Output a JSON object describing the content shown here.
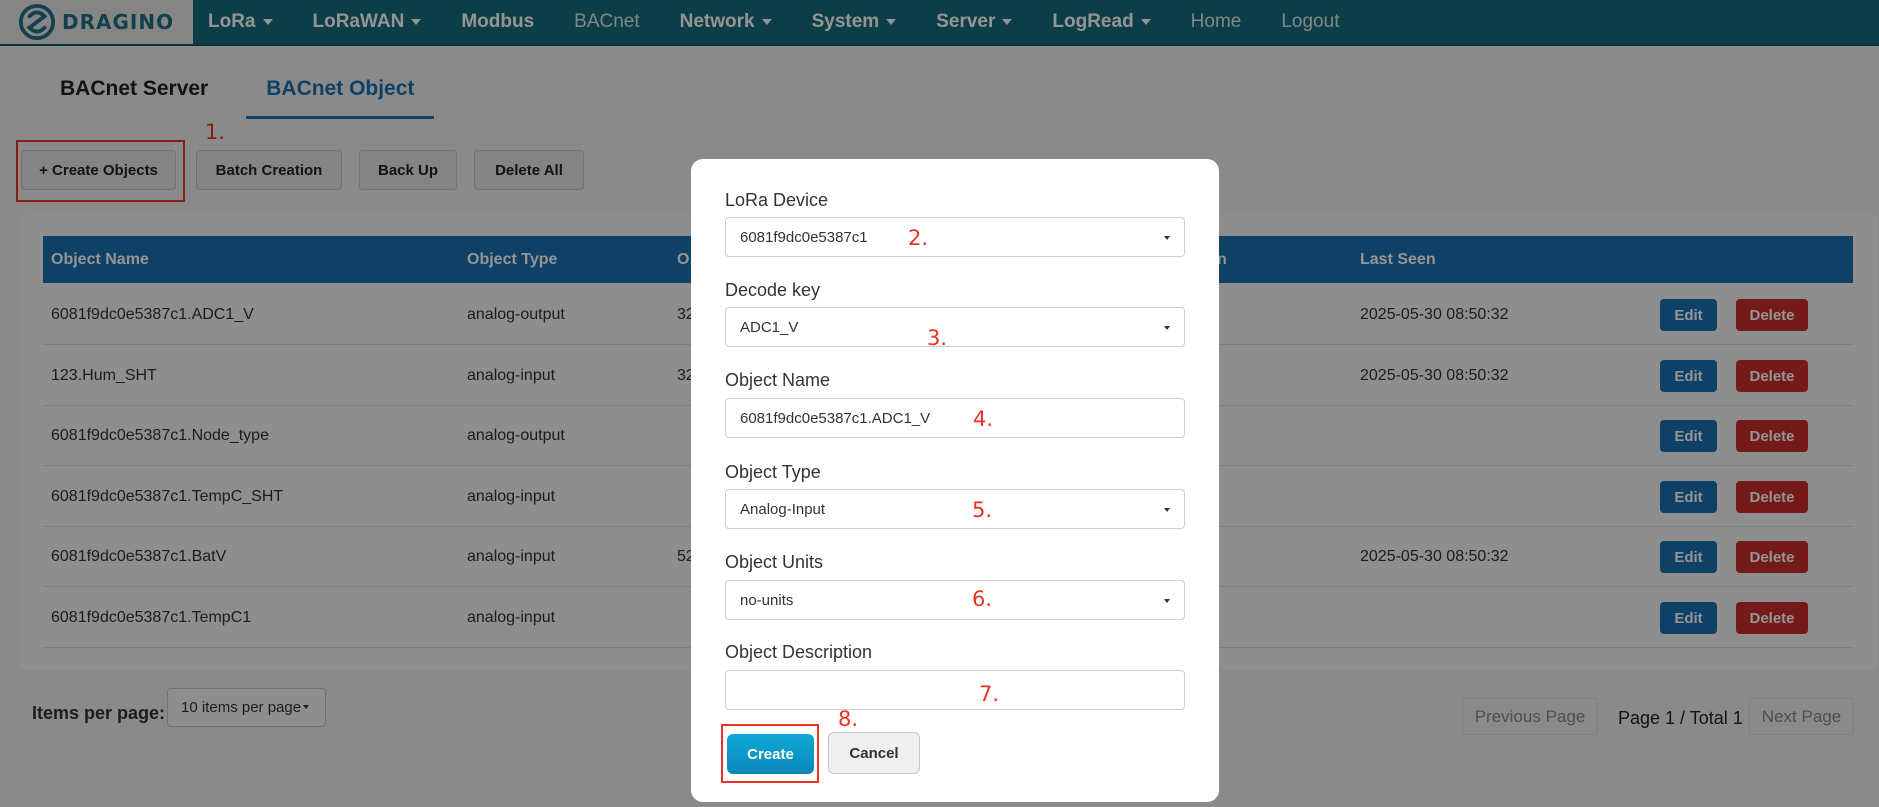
{
  "brand": {
    "name": "DRAGINO",
    "logo_icon": "dragino-logo-icon",
    "color": "#1f6f86"
  },
  "nav": {
    "items": [
      {
        "label": "LoRa",
        "dropdown": true
      },
      {
        "label": "LoRaWAN",
        "dropdown": true
      },
      {
        "label": "Modbus",
        "dropdown": false
      },
      {
        "label": "BACnet",
        "dropdown": false
      },
      {
        "label": "Network",
        "dropdown": true
      },
      {
        "label": "System",
        "dropdown": true
      },
      {
        "label": "Server",
        "dropdown": true
      },
      {
        "label": "LogRead",
        "dropdown": true
      },
      {
        "label": "Home",
        "dropdown": false
      },
      {
        "label": "Logout",
        "dropdown": false
      }
    ],
    "bg_color": "#186c7c"
  },
  "tabs": [
    {
      "label": "BACnet Server",
      "active": false
    },
    {
      "label": "BACnet Object",
      "active": true
    }
  ],
  "toolbar": {
    "create_label": "+ Create Objects",
    "batch_label": "Batch Creation",
    "backup_label": "Back Up",
    "delete_all_label": "Delete All"
  },
  "annotations": {
    "a1": "1.",
    "a2": "2.",
    "a3": "3.",
    "a4": "4.",
    "a5": "5.",
    "a6": "6.",
    "a7": "7.",
    "a8": "8.",
    "color": "#ea3323"
  },
  "table": {
    "columns": [
      "Object Name",
      "Object Type",
      "O",
      "n",
      "Last Seen"
    ],
    "rows": [
      {
        "name": "6081f9dc0e5387c1.ADC1_V",
        "type": "analog-output",
        "val": "32",
        "last_seen": "2025-05-30 08:50:32"
      },
      {
        "name": "123.Hum_SHT",
        "type": "analog-input",
        "val": "32",
        "last_seen": "2025-05-30 08:50:32"
      },
      {
        "name": "6081f9dc0e5387c1.Node_type",
        "type": "analog-output",
        "val": "",
        "last_seen": ""
      },
      {
        "name": "6081f9dc0e5387c1.TempC_SHT",
        "type": "analog-input",
        "val": "",
        "last_seen": ""
      },
      {
        "name": "6081f9dc0e5387c1.BatV",
        "type": "analog-input",
        "val": "52",
        "last_seen": "2025-05-30 08:50:32"
      },
      {
        "name": "6081f9dc0e5387c1.TempC1",
        "type": "analog-input",
        "val": "",
        "last_seen": ""
      }
    ],
    "edit_label": "Edit",
    "delete_label": "Delete",
    "header_color": "#1b6fb0"
  },
  "footer": {
    "items_per_page_label": "Items per page:",
    "items_per_page_value": "10 items per page",
    "prev_label": "Previous Page",
    "page_info": "Page 1 / Total 1",
    "next_label": "Next Page"
  },
  "modal": {
    "lora_device": {
      "label": "LoRa Device",
      "value": "6081f9dc0e5387c1"
    },
    "decode_key": {
      "label": "Decode key",
      "value": "ADC1_V"
    },
    "object_name": {
      "label": "Object Name",
      "value": "6081f9dc0e5387c1.ADC1_V"
    },
    "object_type": {
      "label": "Object Type",
      "value": "Analog-Input"
    },
    "object_units": {
      "label": "Object Units",
      "value": "no-units"
    },
    "object_description": {
      "label": "Object Description",
      "value": ""
    },
    "create_label": "Create",
    "cancel_label": "Cancel"
  }
}
